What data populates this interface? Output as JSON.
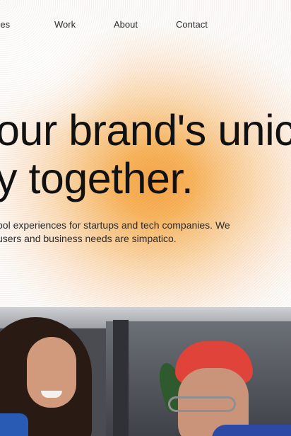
{
  "nav": {
    "items": [
      "ices",
      "Work",
      "About",
      "Contact"
    ]
  },
  "hero": {
    "headline_line1": "our brand's unic",
    "headline_line2": "y together.",
    "body_line1": "ool experiences for startups and tech companies. We",
    "body_line2": "users and business needs are simpatico."
  },
  "colors": {
    "glow": "#f7a64a",
    "text": "#111111"
  }
}
